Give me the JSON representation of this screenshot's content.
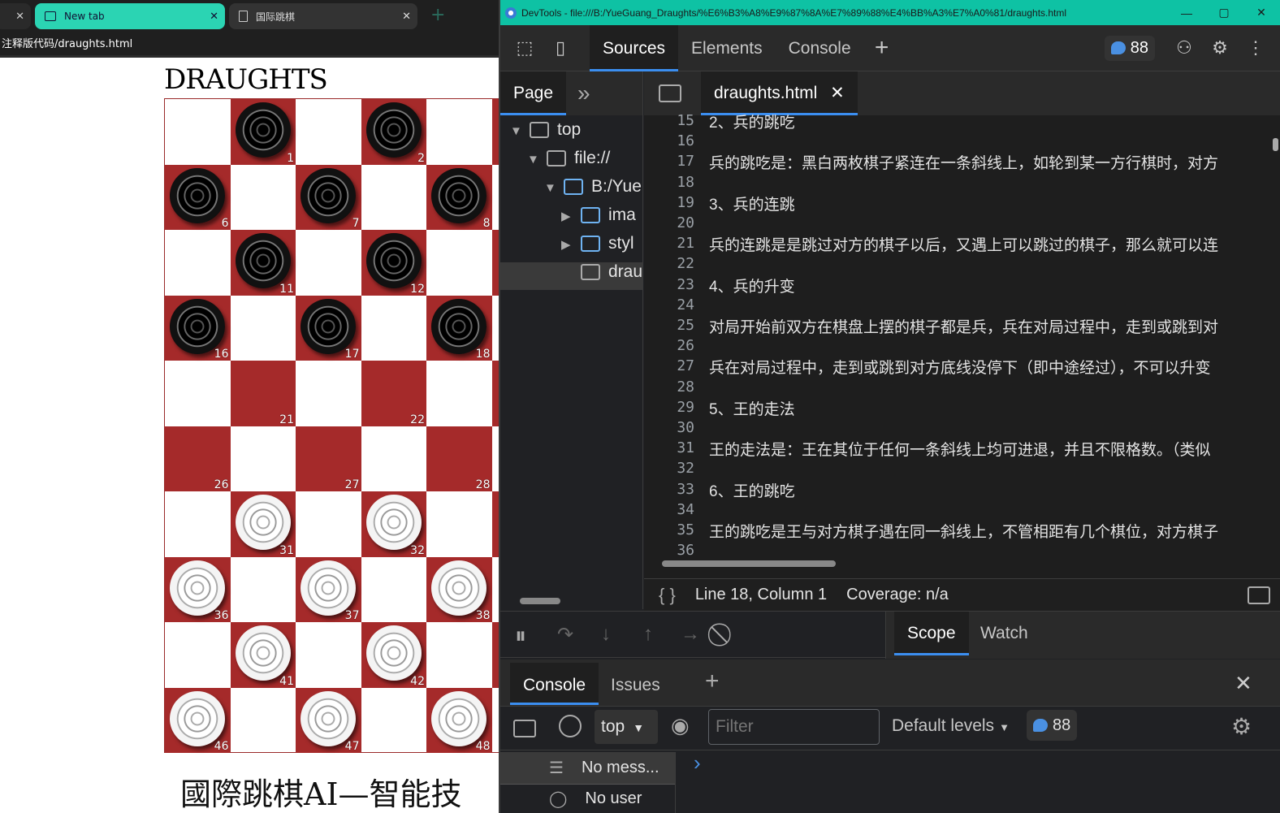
{
  "browser": {
    "tabs": [
      {
        "label": "",
        "close": "✕"
      },
      {
        "label": "New tab",
        "close": "✕"
      },
      {
        "label": "国际跳棋",
        "close": "✕"
      }
    ],
    "new_tab": "+",
    "url": "注释版代码/draughts.html"
  },
  "page": {
    "title": "DRAUGHTS",
    "caption": "國際跳棋AI—智能技",
    "board": {
      "black_squares": [
        1,
        2,
        6,
        7,
        8,
        11,
        12,
        16,
        17,
        18
      ],
      "white_squares": [
        31,
        32,
        36,
        37,
        38,
        41,
        42,
        46,
        47,
        48
      ],
      "empty_numbered_squares": [
        21,
        22,
        26,
        27,
        28
      ]
    }
  },
  "devtools": {
    "window_title": "DevTools - file:///B:/YueGuang_Draughts/%E6%B3%A8%E9%87%8A%E7%89%88%E4%BB%A3%E7%A0%81/draughts.html",
    "window_buttons": [
      "—",
      "▢",
      "✕"
    ],
    "panel_tabs": [
      "Sources",
      "Elements",
      "Console"
    ],
    "add_panel": "+",
    "message_count": "88",
    "left_tabs": {
      "page": "Page",
      "more": "»"
    },
    "tree": [
      {
        "label": "top",
        "indent": 0,
        "arrow": "▼"
      },
      {
        "label": "file://",
        "indent": 1,
        "arrow": "▼"
      },
      {
        "label": "B:/Yue",
        "indent": 2,
        "arrow": "▼"
      },
      {
        "label": "ima",
        "indent": 3,
        "arrow": "▶"
      },
      {
        "label": "styl",
        "indent": 3,
        "arrow": "▶"
      },
      {
        "label": "drau",
        "indent": 3,
        "arrow": ""
      }
    ],
    "editor_tab": "draughts.html",
    "lines": [
      {
        "n": "15",
        "text": "2、兵的跳吃"
      },
      {
        "n": "16",
        "text": ""
      },
      {
        "n": "17",
        "text": "兵的跳吃是：黑白两枚棋子紧连在一条斜线上，如轮到某一方行棋时，对方"
      },
      {
        "n": "18",
        "text": ""
      },
      {
        "n": "19",
        "text": "3、兵的连跳"
      },
      {
        "n": "20",
        "text": ""
      },
      {
        "n": "21",
        "text": "兵的连跳是是跳过对方的棋子以后，又遇上可以跳过的棋子，那么就可以连"
      },
      {
        "n": "22",
        "text": ""
      },
      {
        "n": "23",
        "text": "4、兵的升变"
      },
      {
        "n": "24",
        "text": ""
      },
      {
        "n": "25",
        "text": "对局开始前双方在棋盘上摆的棋子都是兵，兵在对局过程中，走到或跳到对"
      },
      {
        "n": "26",
        "text": ""
      },
      {
        "n": "27",
        "text": "兵在对局过程中，走到或跳到对方底线没停下（即中途经过），不可以升变"
      },
      {
        "n": "28",
        "text": ""
      },
      {
        "n": "29",
        "text": "5、王的走法"
      },
      {
        "n": "30",
        "text": ""
      },
      {
        "n": "31",
        "text": "王的走法是：王在其位于任何一条斜线上均可进退，并且不限格数。（类似"
      },
      {
        "n": "32",
        "text": ""
      },
      {
        "n": "33",
        "text": "6、王的跳吃"
      },
      {
        "n": "34",
        "text": ""
      },
      {
        "n": "35",
        "text": "王的跳吃是王与对方棋子遇在同一斜线上，不管相距有几个棋位，对方棋子"
      },
      {
        "n": "36",
        "text": ""
      }
    ],
    "status": {
      "braces": "{ }",
      "position": "Line 18, Column 1",
      "coverage": "Coverage: n/a"
    },
    "side_tabs": [
      "Scope",
      "Watch"
    ],
    "drawer": {
      "tabs": [
        "Console",
        "Issues"
      ],
      "add": "+",
      "context": "top",
      "filter_placeholder": "Filter",
      "levels": "Default levels",
      "count": "88",
      "sidebar": [
        "No mess...",
        "No user"
      ],
      "prompt": "›"
    }
  }
}
